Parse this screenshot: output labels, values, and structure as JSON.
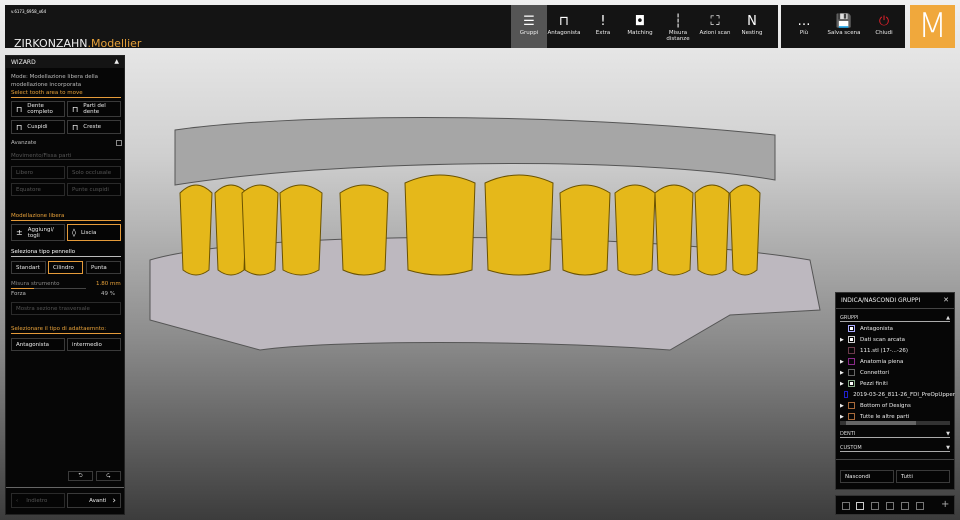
{
  "app": {
    "version": "v.6173_6958_x64",
    "brand": "ZIRKONZAHN",
    "product": ".Modellier",
    "logo": "M"
  },
  "toolbar": [
    {
      "label": "Gruppi",
      "icon": "menu-icon",
      "glyph": "☰"
    },
    {
      "label": "Antagonista",
      "icon": "antagonist-icon",
      "glyph": "⊓"
    },
    {
      "label": "Extra",
      "icon": "exclamation-icon",
      "glyph": "!"
    },
    {
      "label": "Matching",
      "icon": "matching-icon",
      "glyph": "◘"
    },
    {
      "label": "Misura distanze",
      "icon": "ruler-icon",
      "glyph": "┆"
    },
    {
      "label": "Azioni scan",
      "icon": "scan-icon",
      "glyph": "⛶"
    },
    {
      "label": "Nesting",
      "icon": "nesting-icon",
      "glyph": "N"
    }
  ],
  "toolbar2": [
    {
      "label": "Più",
      "icon": "more-icon",
      "glyph": "…"
    },
    {
      "label": "Salva scena",
      "icon": "save-icon",
      "glyph": "💾"
    },
    {
      "label": "Chiudi",
      "icon": "power-icon",
      "glyph": "⏻"
    }
  ],
  "wizard": {
    "title": "WIZARD",
    "mode": "Mode: Modellazione libera della modellazione incorporata",
    "select_area": "Select tooth area to move",
    "area_buttons": [
      "Dente completo",
      "Parti del dente",
      "Cuspidi",
      "Creste"
    ],
    "advanced": "Avanzate",
    "movement": "Movimento/Fissa parti",
    "movement_buttons": [
      "Libero",
      "Solo occlusale",
      "Equatore",
      "Punte cuspidi"
    ],
    "free_modeling": "Modellazione libera",
    "free_buttons": [
      "Aggiungi/ togli",
      "Liscia"
    ],
    "brush_type": "Seleziona tipo pennello",
    "brush_buttons": [
      "Standart",
      "Cilindro",
      "Punta"
    ],
    "tool_size_label": "Misura strumento",
    "tool_size_value": "1.80",
    "tool_size_unit": "mm",
    "force_label": "Forza",
    "force_value": "49",
    "force_unit": "%",
    "cross_section": "Mostra sezione trasversale",
    "adapt_type": "Selezionare il tipo di adattaemnto:",
    "adapt_buttons": [
      "Antagonista",
      "intermedio"
    ],
    "back": "Indietro",
    "next": "Avanti"
  },
  "groups": {
    "title": "INDICA/NASCONDI GRUPPI",
    "section": "GRUPPI",
    "items": [
      {
        "label": "Antagonista",
        "expand": false,
        "checked": true,
        "color": "#aaaaff"
      },
      {
        "label": "Dati scan arcata",
        "expand": true,
        "checked": true,
        "color": "#cccccc"
      },
      {
        "label": "111.stl (17-...-26)",
        "expand": false,
        "checked": false,
        "color": "#6a3a4a"
      },
      {
        "label": "Anatomia piena",
        "expand": true,
        "checked": false,
        "color": "#8a2a8a"
      },
      {
        "label": "Connettori",
        "expand": true,
        "checked": false,
        "color": "#666666"
      },
      {
        "label": "Pezzi finiti",
        "expand": true,
        "checked": true,
        "color": "#88aa88"
      },
      {
        "label": "2019-03-26_811-26_FDI_PreOpUpper",
        "expand": false,
        "checked": false,
        "color": "#2020cc"
      },
      {
        "label": "Bottom of Designs",
        "expand": true,
        "checked": false,
        "color": "#a86a3a"
      },
      {
        "label": "Tutte le altre parti",
        "expand": true,
        "checked": false,
        "color": "#a86a3a"
      }
    ],
    "denti": "DENTI",
    "custom": "CUSTOM",
    "hide": "Nascondi",
    "all": "Tutti"
  }
}
